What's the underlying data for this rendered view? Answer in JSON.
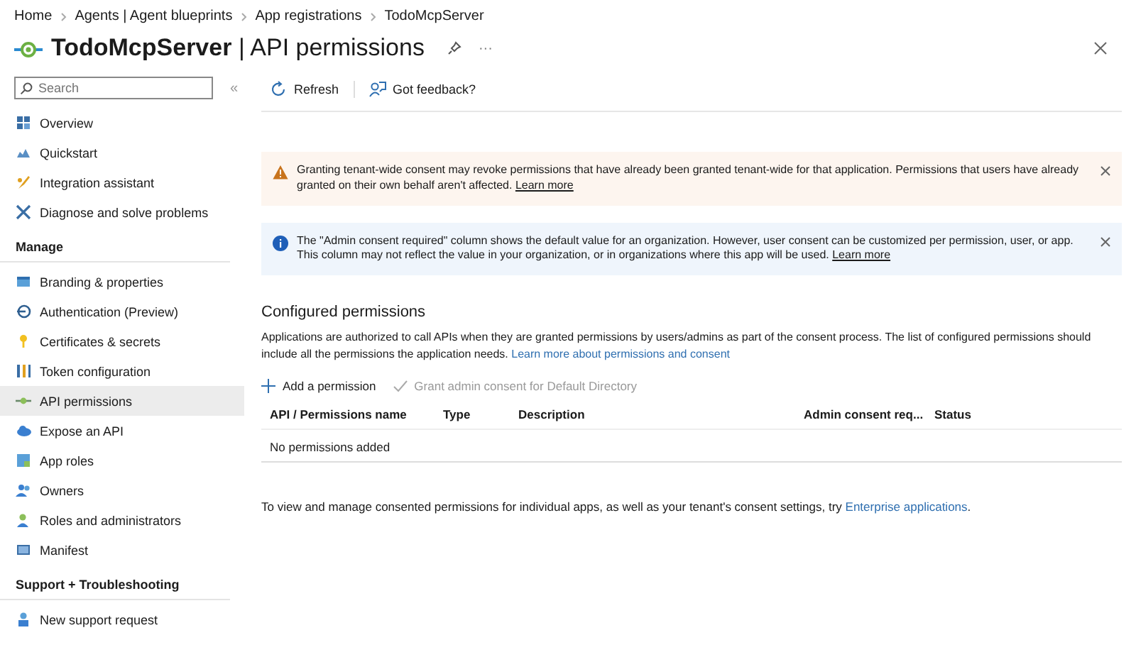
{
  "breadcrumb": [
    "Home",
    "Agents | Agent blueprints",
    "App registrations",
    "TodoMcpServer"
  ],
  "header": {
    "title": "**TodoMcpServer** | API permissions",
    "more": "···"
  },
  "sidebar": {
    "search": {
      "placeholder": "Search"
    },
    "collapse": "«",
    "groups": [
      {
        "items": [
          {
            "label": "Overview",
            "selected": false
          },
          {
            "label": "Quickstart",
            "selected": false
          },
          {
            "label": "Integration assistant",
            "selected": false
          },
          {
            "label": "Diagnose and solve problems",
            "selected": false
          }
        ]
      },
      {
        "heading": "Manage",
        "items": [
          {
            "label": "Branding & properties",
            "selected": false
          },
          {
            "label": "Authentication (Preview)",
            "selected": false
          },
          {
            "label": "Certificates & secrets",
            "selected": false
          },
          {
            "label": "Token configuration",
            "selected": false
          },
          {
            "label": "API permissions",
            "selected": true
          },
          {
            "label": "Expose an API",
            "selected": false
          },
          {
            "label": "App roles",
            "selected": false
          },
          {
            "label": "Owners",
            "selected": false
          },
          {
            "label": "Roles and administrators",
            "selected": false
          },
          {
            "label": "Manifest",
            "selected": false
          }
        ]
      },
      {
        "heading": "Support + Troubleshooting",
        "items": [
          {
            "label": "New support request",
            "selected": false
          }
        ]
      }
    ]
  },
  "toolbar": [
    "Refresh",
    "Got feedback?"
  ],
  "notices": [
    {
      "kind": "warning",
      "text": "Granting tenant-wide consent may revoke permissions that have already been granted tenant-wide for that application. Permissions that users have already granted on their own behalf aren't affected.",
      "link": "Learn more"
    },
    {
      "kind": "info",
      "text": "The \"Admin consent required\" column shows the default value for an organization. However, user consent can be customized per permission, user, or app. This column may not reflect the value in your organization, or in organizations where this app will be used.",
      "link": "Learn more"
    }
  ],
  "configured": {
    "heading": "Configured permissions",
    "description": "Applications are authorized to call APIs when they are granted permissions by users/admins as part of the consent process. The list of configured permissions should include all the permissions the application needs.",
    "link": "Learn more about permissions and consent",
    "actions": [
      {
        "label": "Add a permission",
        "disabled": false
      },
      {
        "label": "Grant admin consent for Default Directory",
        "disabled": true
      }
    ],
    "table": {
      "columns": [
        "API / Permissions name",
        "Type",
        "Description",
        "Admin consent req...",
        "Status"
      ],
      "empty": "No permissions added"
    }
  },
  "footer": {
    "text": "To view and manage consented permissions for individual apps, as well as your tenant's consent settings, try",
    "link": "Enterprise applications",
    "end": "."
  }
}
